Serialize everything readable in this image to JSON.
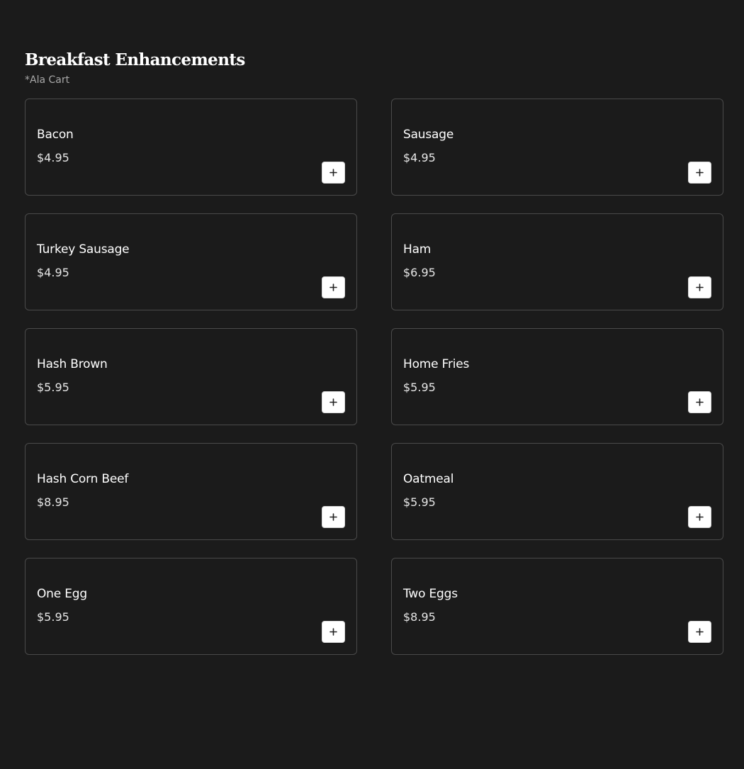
{
  "section": {
    "title": "Breakfast Enhancements",
    "subtitle": "*Ala Cart"
  },
  "items": [
    {
      "name": "Bacon",
      "price": "$4.95",
      "icon": "plus-icon"
    },
    {
      "name": "Sausage",
      "price": "$4.95",
      "icon": "plus-icon"
    },
    {
      "name": "Turkey Sausage",
      "price": "$4.95",
      "icon": "plus-icon"
    },
    {
      "name": "Ham",
      "price": "$6.95",
      "icon": "plus-icon"
    },
    {
      "name": "Hash Brown",
      "price": "$5.95",
      "icon": "plus-icon"
    },
    {
      "name": "Home Fries",
      "price": "$5.95",
      "icon": "plus-icon"
    },
    {
      "name": "Hash Corn Beef",
      "price": "$8.95",
      "icon": "plus-icon"
    },
    {
      "name": "Oatmeal",
      "price": "$5.95",
      "icon": "plus-icon"
    },
    {
      "name": "One Egg",
      "price": "$5.95",
      "icon": "plus-icon"
    },
    {
      "name": "Two Eggs",
      "price": "$8.95",
      "icon": "plus-icon"
    }
  ],
  "colors": {
    "background": "#1b1b1b",
    "card_border": "#4a4a4a",
    "text": "#ffffff",
    "subtitle": "#a8a8a8",
    "button_background": "#ffffff",
    "button_icon": "#222222"
  }
}
